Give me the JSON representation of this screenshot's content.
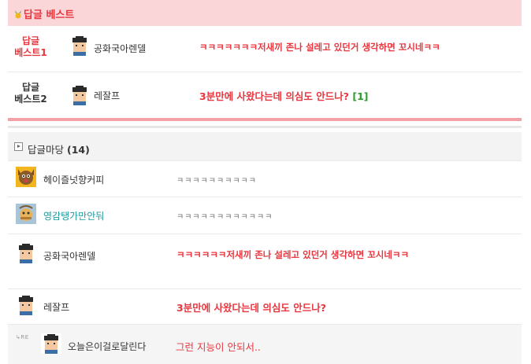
{
  "best": {
    "header_title": "답글 베스트",
    "items": [
      {
        "label_line1": "답글",
        "label_line2": "베스트1",
        "nickname": "공화국아렌델",
        "comment": "ㅋㅋㅋㅋㅋㅋㅋ저새끼 존나 설레고 있던거 생각하면 꼬시네ㅋㅋ"
      },
      {
        "label_line1": "답글",
        "label_line2": "베스트2",
        "nickname": "레잘프",
        "comment": "3분만에 사왔다는데 의심도 안드나?",
        "reply_count": "[1]"
      }
    ]
  },
  "madang": {
    "title": "답글마당",
    "count": "(14)",
    "comments": [
      {
        "nickname": "헤이즐넛향커피",
        "comment": "ㅋㅋㅋㅋㅋㅋㅋㅋㅋㅋ"
      },
      {
        "nickname": "영감탱가만안둬",
        "comment": "ㅋㅋㅋㅋㅋㅋㅋㅋㅋㅋㅋㅋ"
      },
      {
        "nickname": "공화국아렌델",
        "comment": "ㅋㅋㅋㅋㅋㅋ저새끼 존나 설레고 있던거 생각하면 꼬시네ㅋㅋ"
      },
      {
        "nickname": "레잘프",
        "comment": "3분만에 사왔다는데 의심도 안드나?"
      },
      {
        "re_mark": "RE",
        "nickname": "오늘은이걸로달린다",
        "comment": "그런 지능이 안되서.."
      }
    ]
  },
  "colors": {
    "accent_red": "#e8363f",
    "header_pink": "#fbd6d8",
    "nick_teal": "#1d9a9d",
    "reply_green": "#2a9d2a"
  }
}
